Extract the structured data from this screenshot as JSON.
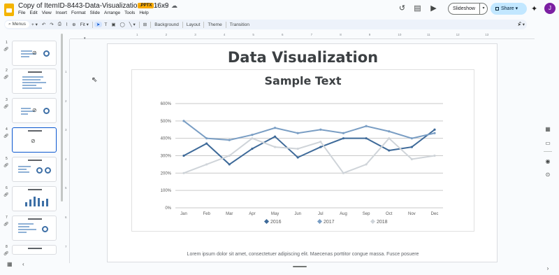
{
  "window": {
    "doc_title": "Copy of ItemID-8443-Data-Visualization-03-16x9",
    "badge": ".PPTX"
  },
  "menu": [
    "File",
    "Edit",
    "View",
    "Insert",
    "Format",
    "Slide",
    "Arrange",
    "Tools",
    "Help"
  ],
  "header_buttons": {
    "slideshow": "Slideshow",
    "share": "Share",
    "avatar_initial": "J"
  },
  "toolbar": {
    "search": "Menus",
    "zoom": "Fit",
    "background": "Background",
    "layout": "Layout",
    "theme": "Theme",
    "transition": "Transition"
  },
  "filmstrip": {
    "slide_numbers": [
      "1",
      "2",
      "3",
      "4",
      "5",
      "6",
      "7",
      "8"
    ],
    "selected": "4"
  },
  "ruler": {
    "top": [
      "1",
      "2",
      "3",
      "4",
      "5",
      "6",
      "7",
      "8",
      "9",
      "10",
      "11",
      "12",
      "13"
    ],
    "left": [
      "1",
      "2",
      "3",
      "4",
      "5",
      "6",
      "7"
    ]
  },
  "slide": {
    "title": "Data Visualization",
    "footer": "Lorem ipsum dolor sit amet, consectetuer adipiscing elit. Maecenas porttitor congue massa. Fusce posuere"
  },
  "chart_data": {
    "type": "line",
    "title": "Sample Text",
    "categories": [
      "Jan",
      "Feb",
      "Mar",
      "Apr",
      "May",
      "Jun",
      "Jul",
      "Aug",
      "Sep",
      "Oct",
      "Nov",
      "Dec"
    ],
    "y_ticks": [
      "0%",
      "100%",
      "200%",
      "300%",
      "400%",
      "500%",
      "600%"
    ],
    "ylim": [
      0,
      600
    ],
    "grid": true,
    "legend_position": "bottom",
    "series": [
      {
        "name": "2016",
        "color": "#3e6a99",
        "values": [
          300,
          370,
          250,
          340,
          410,
          290,
          350,
          400,
          400,
          330,
          350,
          450
        ]
      },
      {
        "name": "2017",
        "color": "#7a9ec4",
        "values": [
          500,
          400,
          390,
          420,
          460,
          430,
          450,
          430,
          470,
          440,
          400,
          430
        ]
      },
      {
        "name": "2018",
        "color": "#cfd4d9",
        "values": [
          200,
          250,
          300,
          400,
          350,
          340,
          380,
          200,
          250,
          400,
          280,
          300
        ]
      }
    ]
  }
}
